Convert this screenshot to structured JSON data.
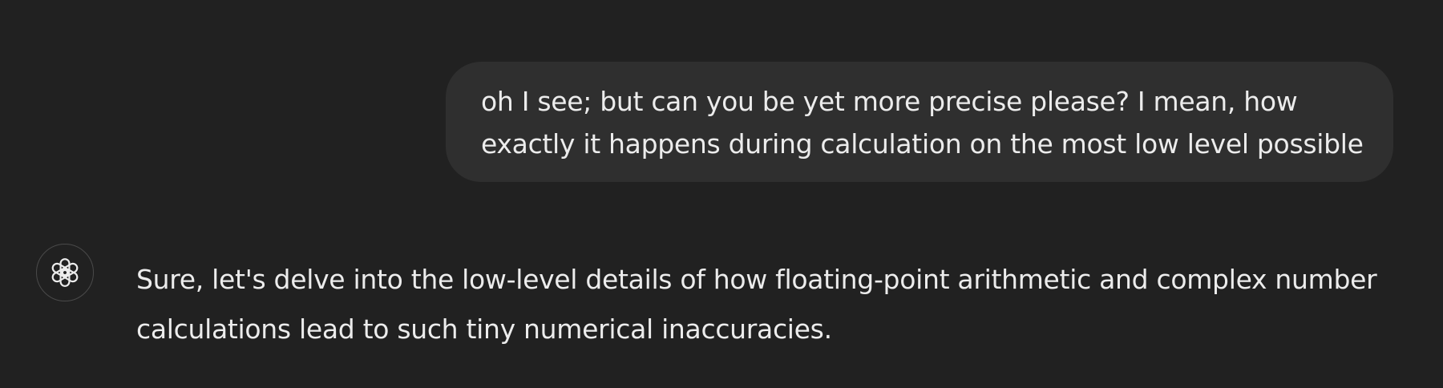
{
  "conversation": {
    "user_message": {
      "lines": [
        "oh I see; but can you be yet more precise please? I mean, how",
        "exactly it happens during calculation on the most low level possible"
      ]
    },
    "assistant_message": {
      "avatar_icon": "openai-logo-icon",
      "lines": [
        "Sure, let's delve into the low-level details of how floating-point arithmetic and complex number",
        "calculations lead to such tiny numerical inaccuracies."
      ]
    }
  },
  "colors": {
    "background": "#212121",
    "user_bubble": "#2f2f2f",
    "text": "#ececec",
    "avatar_border": "#4a4a4a"
  }
}
